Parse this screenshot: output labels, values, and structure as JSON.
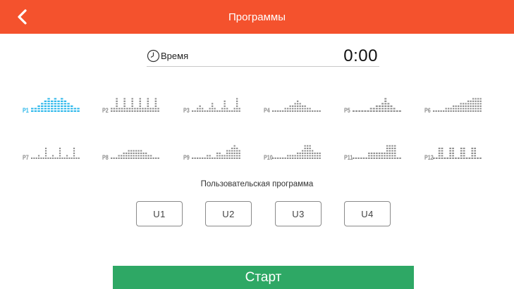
{
  "colors": {
    "header_bg": "#f4522d",
    "start_bg": "#2ea865",
    "selected": "#27b6ea",
    "bars": "#8c8c8c"
  },
  "header": {
    "title": "Программы",
    "back_icon": "chevron-left-icon"
  },
  "time": {
    "icon": "clock-icon",
    "label": "Время",
    "value": "0:00"
  },
  "programs": [
    {
      "label": "P1",
      "selected": true,
      "profile": [
        2,
        2,
        3,
        4,
        5,
        6,
        5,
        6,
        5,
        6,
        5,
        4,
        3,
        2,
        2
      ]
    },
    {
      "label": "P2",
      "selected": false,
      "profile": [
        2,
        2,
        6,
        2,
        2,
        6,
        2,
        2,
        6,
        2,
        2,
        6,
        2,
        2,
        6,
        2,
        2,
        6,
        2
      ]
    },
    {
      "label": "P3",
      "selected": false,
      "profile": [
        1,
        1,
        2,
        3,
        2,
        1,
        1,
        2,
        4,
        2,
        1,
        1,
        2,
        5,
        2,
        1,
        1,
        2,
        6,
        2
      ]
    },
    {
      "label": "P4",
      "selected": false,
      "profile": [
        1,
        1,
        1,
        1,
        1,
        2,
        2,
        3,
        3,
        4,
        5,
        4,
        3,
        3,
        2,
        2,
        1,
        1,
        1,
        1
      ]
    },
    {
      "label": "P5",
      "selected": false,
      "profile": [
        1,
        1,
        1,
        1,
        1,
        1,
        2,
        2,
        3,
        3,
        4,
        6,
        4,
        3,
        2,
        1,
        1
      ]
    },
    {
      "label": "P6",
      "selected": false,
      "profile": [
        1,
        1,
        1,
        1,
        1,
        2,
        2,
        2,
        3,
        3,
        3,
        4,
        4,
        4,
        5,
        5,
        6,
        6,
        6,
        6
      ]
    },
    {
      "label": "P7",
      "selected": false,
      "profile": [
        1,
        1,
        1,
        2,
        1,
        1,
        5,
        1,
        1,
        2,
        1,
        1,
        5,
        1,
        1,
        2,
        1,
        1,
        5,
        1,
        1
      ]
    },
    {
      "label": "P8",
      "selected": false,
      "profile": [
        1,
        1,
        1,
        2,
        2,
        3,
        3,
        4,
        4,
        4,
        4,
        4,
        4,
        3,
        3,
        2,
        2,
        1,
        1,
        1
      ]
    },
    {
      "label": "P9",
      "selected": false,
      "profile": [
        1,
        1,
        1,
        1,
        1,
        1,
        2,
        2,
        1,
        1,
        3,
        3,
        2,
        2,
        4,
        4,
        5,
        6,
        5,
        4
      ]
    },
    {
      "label": "P10",
      "selected": false,
      "profile": [
        1,
        1,
        1,
        1,
        1,
        1,
        2,
        2,
        2,
        2,
        3,
        3,
        4,
        6,
        6,
        6,
        4,
        3,
        3,
        3
      ]
    },
    {
      "label": "P11",
      "selected": false,
      "profile": [
        1,
        1,
        1,
        1,
        1,
        1,
        3,
        3,
        3,
        3,
        3,
        3,
        3,
        6,
        6,
        6,
        6,
        1,
        1
      ]
    },
    {
      "label": "P12",
      "selected": false,
      "profile": [
        1,
        1,
        5,
        5,
        1,
        1,
        5,
        5,
        1,
        1,
        5,
        5,
        1,
        1,
        5,
        5,
        1,
        1
      ]
    }
  ],
  "user_programs": {
    "title": "Пользовательская программа",
    "buttons": [
      "U1",
      "U2",
      "U3",
      "U4"
    ]
  },
  "start_label": "Старт"
}
